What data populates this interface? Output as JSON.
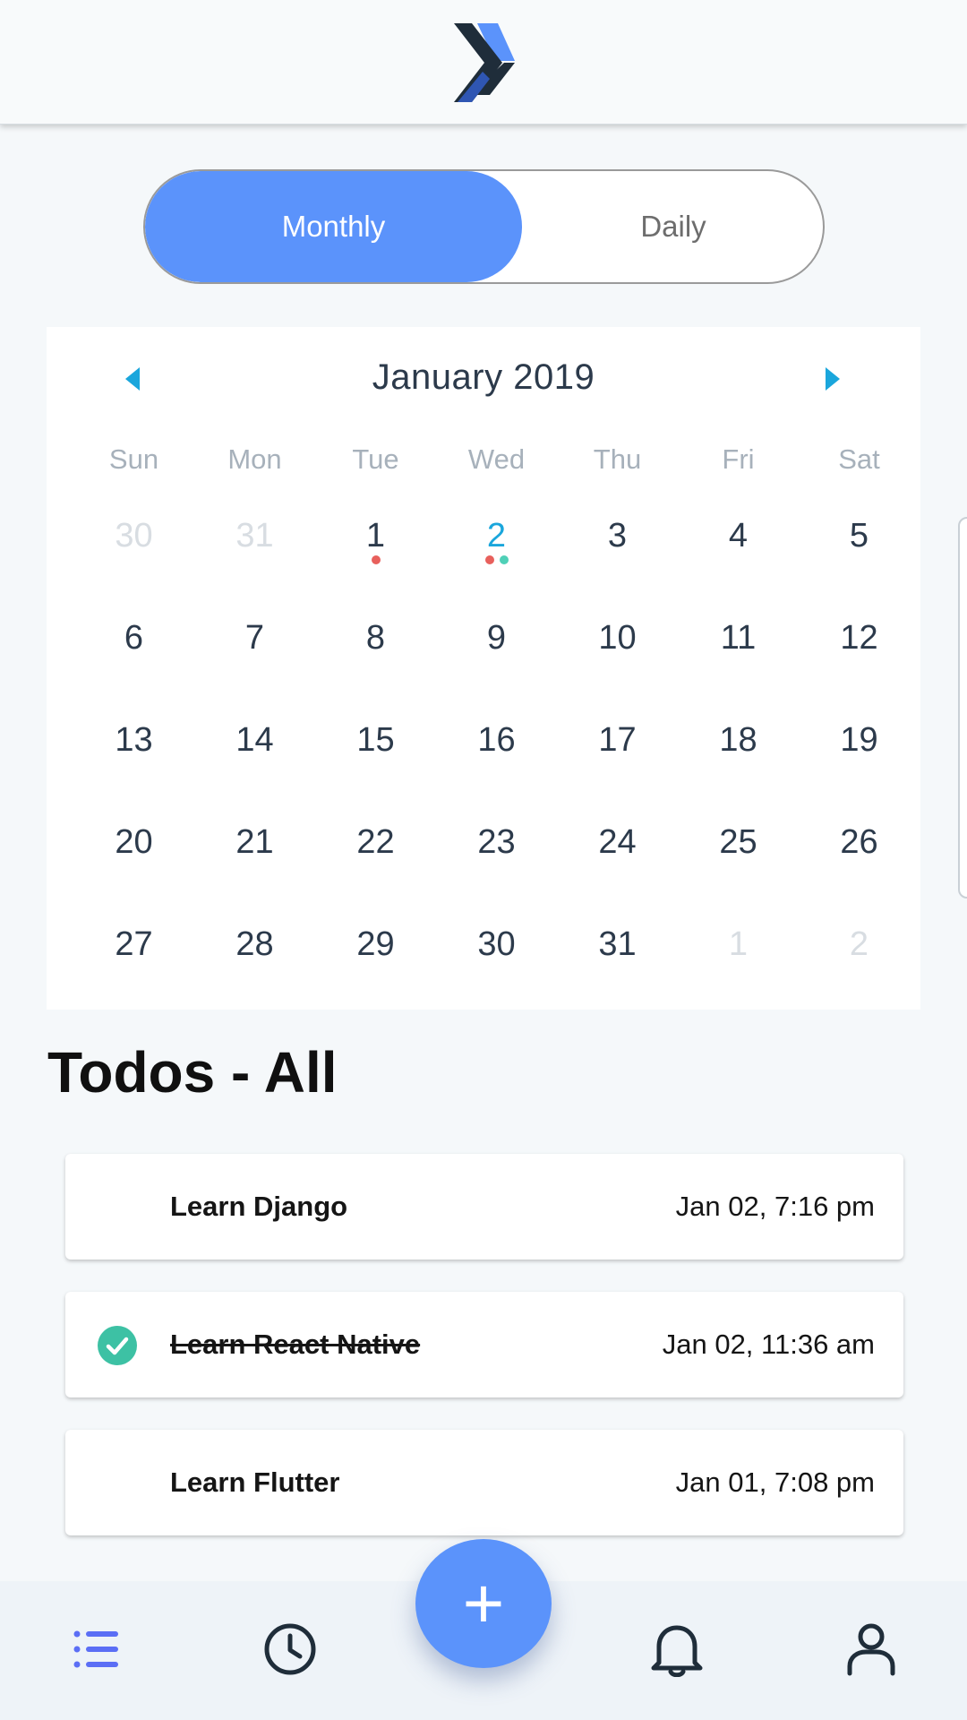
{
  "toggle": {
    "monthly": "Monthly",
    "daily": "Daily",
    "selected": "Monthly"
  },
  "calendar": {
    "title": "January 2019",
    "weekdays": [
      "Sun",
      "Mon",
      "Tue",
      "Wed",
      "Thu",
      "Fri",
      "Sat"
    ],
    "weeks": [
      [
        {
          "d": "30",
          "muted": true
        },
        {
          "d": "31",
          "muted": true
        },
        {
          "d": "1",
          "dots": [
            "#e8605c"
          ]
        },
        {
          "d": "2",
          "today": true,
          "dots": [
            "#e8605c",
            "#4fd0b7"
          ]
        },
        {
          "d": "3"
        },
        {
          "d": "4"
        },
        {
          "d": "5"
        }
      ],
      [
        {
          "d": "6"
        },
        {
          "d": "7"
        },
        {
          "d": "8"
        },
        {
          "d": "9"
        },
        {
          "d": "10"
        },
        {
          "d": "11"
        },
        {
          "d": "12"
        }
      ],
      [
        {
          "d": "13"
        },
        {
          "d": "14"
        },
        {
          "d": "15"
        },
        {
          "d": "16"
        },
        {
          "d": "17"
        },
        {
          "d": "18"
        },
        {
          "d": "19"
        }
      ],
      [
        {
          "d": "20"
        },
        {
          "d": "21"
        },
        {
          "d": "22"
        },
        {
          "d": "23"
        },
        {
          "d": "24"
        },
        {
          "d": "25"
        },
        {
          "d": "26"
        }
      ],
      [
        {
          "d": "27"
        },
        {
          "d": "28"
        },
        {
          "d": "29"
        },
        {
          "d": "30"
        },
        {
          "d": "31"
        },
        {
          "d": "1",
          "muted": true
        },
        {
          "d": "2",
          "muted": true
        }
      ]
    ]
  },
  "todos_title": "Todos - All",
  "todos": [
    {
      "name": "Learn Django",
      "date": "Jan 02, 7:16 pm",
      "done": false
    },
    {
      "name": "Learn React Native",
      "date": "Jan 02, 11:36 am",
      "done": true
    },
    {
      "name": "Learn Flutter",
      "date": "Jan 01, 7:08 pm",
      "done": false
    }
  ],
  "fab": {
    "label": "+"
  },
  "nav": [
    "list-icon",
    "clock-icon",
    "add-button",
    "bell-icon",
    "user-icon"
  ],
  "colors": {
    "accent": "#5b93fb",
    "today": "#1aa6dc",
    "done_check": "#3dc1a4",
    "dot_red": "#e8605c",
    "dot_teal": "#4fd0b7"
  }
}
